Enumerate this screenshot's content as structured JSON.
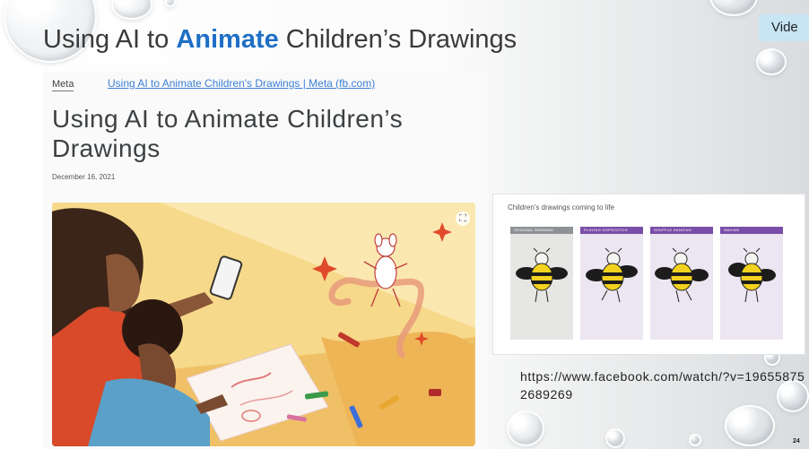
{
  "slide": {
    "title_before": "Using AI to ",
    "title_accent": "Animate",
    "title_after": " Children’s Drawings",
    "video_tab_label": "Vide",
    "page_number": "24",
    "video_url": "https://www.facebook.com/watch/?v=196558752689269"
  },
  "article": {
    "brand": "Meta",
    "link_text": "Using AI to Animate Children's Drawings | Meta (fb.com)",
    "headline": "Using AI to Animate Children’s Drawings",
    "date": "December 16, 2021"
  },
  "demo": {
    "caption": "Children's drawings coming to life",
    "frames": [
      {
        "label": "Original drawing",
        "color": "#8e9296",
        "bg": "#e6e7e5"
      },
      {
        "label": "Playing hopscotch",
        "color": "#7a4ea8",
        "bg": "#ece5f2"
      },
      {
        "label": "Shuffle dancing",
        "color": "#7a4ea8",
        "bg": "#ece5f2"
      },
      {
        "label": "Waving",
        "color": "#7a4ea8",
        "bg": "#ece5f2"
      }
    ]
  },
  "colors": {
    "accent": "#1f6fc5",
    "link": "#3b7fd6",
    "video_tab": "#c7e5f5"
  }
}
